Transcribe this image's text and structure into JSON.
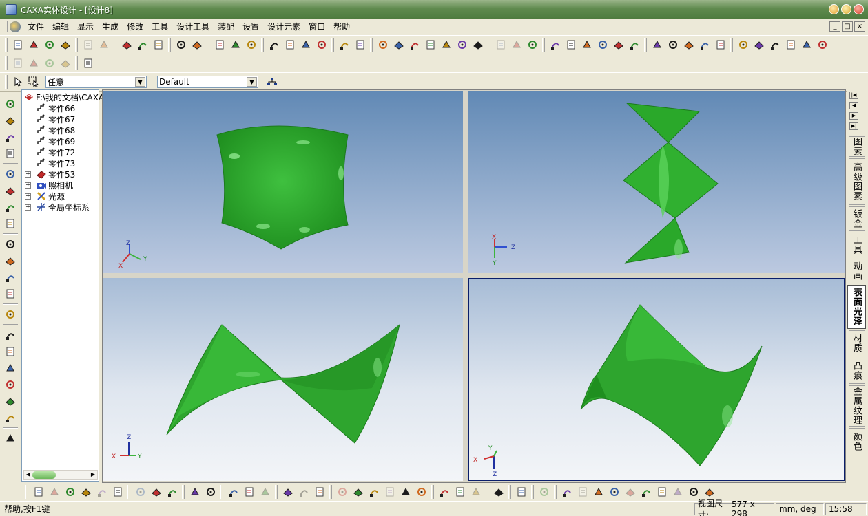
{
  "window": {
    "title": "CAXA实体设计 - [设计8]"
  },
  "menu": {
    "items": [
      "文件",
      "编辑",
      "显示",
      "生成",
      "修改",
      "工具",
      "设计工具",
      "装配",
      "设置",
      "设计元素",
      "窗口",
      "帮助"
    ],
    "mdi_controls": [
      "_",
      "□",
      "×"
    ]
  },
  "toolbar_icons": {
    "row1": [
      "new-doc",
      "new-drawing",
      "open",
      "save",
      "|",
      "undo",
      "redo",
      "|",
      "copy-shape",
      "paste-shape",
      "camera",
      "|",
      "find",
      "help-pointer",
      "|",
      "design-tree",
      "tool-a",
      "tool-b",
      "|",
      "extrude",
      "revolve",
      "sweep",
      "loft",
      "|",
      "text",
      "text-frame",
      "|",
      "curve1",
      "curve2",
      "curve3",
      "curve4",
      "curve5",
      "curve6",
      "curve7",
      "|",
      "face1",
      "face2",
      "face3",
      "|",
      "sm1",
      "sm2",
      "sm3",
      "sm4",
      "sm5",
      "sm6",
      "|",
      "v1",
      "v2",
      "v3",
      "v4",
      "v5",
      "|",
      "view1",
      "view2",
      "view3",
      "view4",
      "view5",
      "view6"
    ],
    "row2": [
      "a",
      "b",
      "c",
      "d",
      "|",
      "e"
    ],
    "left": [
      "move-icon",
      "rotate-icon",
      "orbit-icon",
      "walk-icon",
      "|",
      "zoom-icon",
      "zoom-window-icon",
      "camera-icon",
      "center-icon",
      "|",
      "lightbulb-icon",
      "camera2-icon",
      "camera3-icon",
      "film-icon",
      "|",
      "brush-icon",
      "|",
      "select-icon",
      "box-icon",
      "box2-icon",
      "sphere-icon",
      "knife-icon",
      "globe-icon",
      "|",
      "text-icon"
    ],
    "bottom": [
      "b1",
      "b2",
      "b3",
      "b4",
      "b5",
      "b6",
      "|",
      "b7",
      "b8",
      "b9",
      "|",
      "b10",
      "b11",
      "|",
      "b12",
      "b13",
      "b14",
      "|",
      "b15",
      "b16",
      "b17",
      "|",
      "b18",
      "b19",
      "b20",
      "b21",
      "b22",
      "b23",
      "|",
      "b24",
      "b25",
      "b26",
      "|",
      "b27",
      "|",
      "b28",
      "|",
      "b29",
      "|",
      "b30",
      "b31",
      "b32",
      "b33",
      "b34",
      "b35",
      "b36",
      "b37",
      "b38",
      "b39"
    ]
  },
  "selectors": {
    "filter": "任意",
    "style": "Default"
  },
  "tree": {
    "root": "F:\\我的文档\\CAXA",
    "items": [
      {
        "label": "零件66",
        "kind": "part"
      },
      {
        "label": "零件67",
        "kind": "part"
      },
      {
        "label": "零件68",
        "kind": "part"
      },
      {
        "label": "零件69",
        "kind": "part"
      },
      {
        "label": "零件72",
        "kind": "part"
      },
      {
        "label": "零件73",
        "kind": "part"
      },
      {
        "label": "零件53",
        "kind": "part-red",
        "expand": true
      },
      {
        "label": "照相机",
        "kind": "camera",
        "expand": true
      },
      {
        "label": "光源",
        "kind": "light",
        "expand": true
      },
      {
        "label": "全局坐标系",
        "kind": "coord",
        "expand": true
      }
    ]
  },
  "viewports": {
    "top_left": {
      "axes": [
        "Z",
        "Y",
        "X"
      ]
    },
    "top_right": {
      "axes": [
        "X",
        "Z",
        "Y"
      ]
    },
    "bottom_left": {
      "axes": [
        "Z",
        "X",
        "Y"
      ]
    },
    "bottom_right": {
      "axes": [
        "Y",
        "X",
        "Z"
      ]
    }
  },
  "right_tabs": [
    "图素",
    "高级图素",
    "钣金",
    "工具",
    "动画",
    "表面光泽",
    "材质",
    "凸痕",
    "金属纹理",
    "颜色"
  ],
  "right_tabs_active": "表面光泽",
  "status": {
    "message": "帮助,按F1键",
    "view_size_label": "视图尺寸:",
    "view_size": "577 x 298",
    "units": "mm, deg",
    "time": "15:58"
  },
  "colors": {
    "surface_green": "#2ea52e",
    "titlebar": "#5f8a4e"
  }
}
